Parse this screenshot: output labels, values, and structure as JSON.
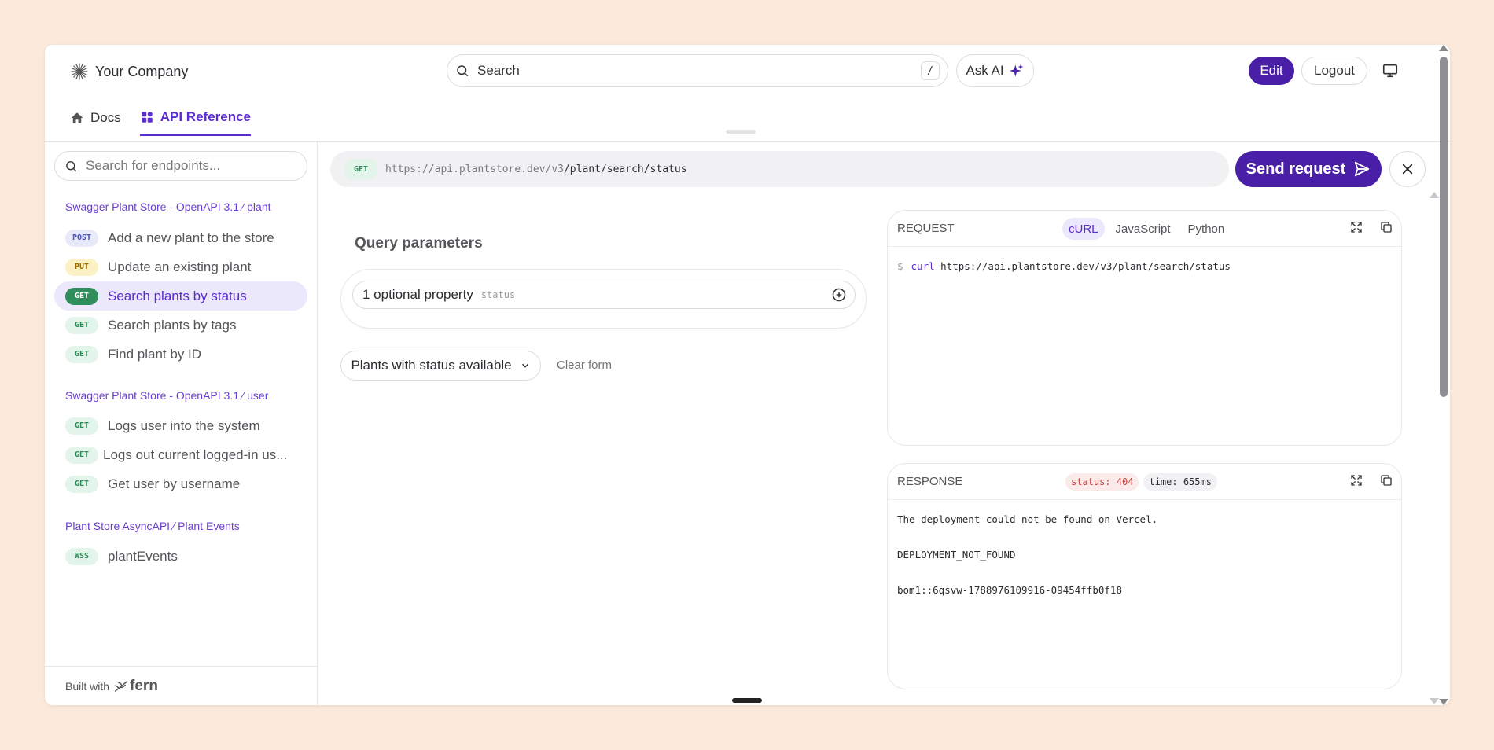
{
  "header": {
    "company": "Your Company",
    "search_label": "Search",
    "search_shortcut": "/",
    "ask_ai": "Ask AI",
    "edit": "Edit",
    "logout": "Logout"
  },
  "tabs": [
    {
      "label": "Docs"
    },
    {
      "label": "API Reference"
    }
  ],
  "sidebar": {
    "search_placeholder": "Search for endpoints...",
    "groups": [
      {
        "title": "Swagger Plant Store - OpenAPI 3.1 ∕ plant",
        "items": [
          {
            "method": "POST",
            "label": "Add a new plant to the store"
          },
          {
            "method": "PUT",
            "label": "Update an existing plant"
          },
          {
            "method": "GET",
            "label": "Search plants by status"
          },
          {
            "method": "GET",
            "label": "Search plants by tags"
          },
          {
            "method": "GET",
            "label": "Find plant by ID"
          }
        ]
      },
      {
        "title": "Swagger Plant Store - OpenAPI 3.1 ∕ user",
        "items": [
          {
            "method": "GET",
            "label": "Logs user into the system"
          },
          {
            "method": "GET",
            "label": "Logs out current logged-in us..."
          },
          {
            "method": "GET",
            "label": "Get user by username"
          }
        ]
      },
      {
        "title": "Plant Store AsyncAPI ∕ Plant Events",
        "items": [
          {
            "method": "WSS",
            "label": "plantEvents"
          }
        ]
      }
    ],
    "built_with": "Built with",
    "brand": "fern"
  },
  "request_bar": {
    "method": "GET",
    "base_url": "https://api.plantstore.dev/v3",
    "path": "/plant/search/status",
    "send_label": "Send request"
  },
  "query": {
    "title": "Query parameters",
    "optional_label": "1 optional property",
    "param_hint": "status",
    "example_select": "Plants with status available",
    "clear_form": "Clear form"
  },
  "request_panel": {
    "title": "REQUEST",
    "langs": [
      "cURL",
      "JavaScript",
      "Python"
    ],
    "active_lang": "cURL",
    "prompt": "$",
    "cmd": "curl",
    "url": "https://api.plantstore.dev/v3/plant/search/status"
  },
  "response_panel": {
    "title": "RESPONSE",
    "status": "status: 404",
    "time": "time: 655ms",
    "lines": [
      "The deployment could not be found on Vercel.",
      "",
      "DEPLOYMENT_NOT_FOUND",
      "",
      "bom1::6qsvw-1788976109916-09454ffb0f18"
    ]
  },
  "colors": {
    "accent": "#4a1fa8",
    "accent_text": "#5b2ccf",
    "background": "#fbe9db"
  }
}
